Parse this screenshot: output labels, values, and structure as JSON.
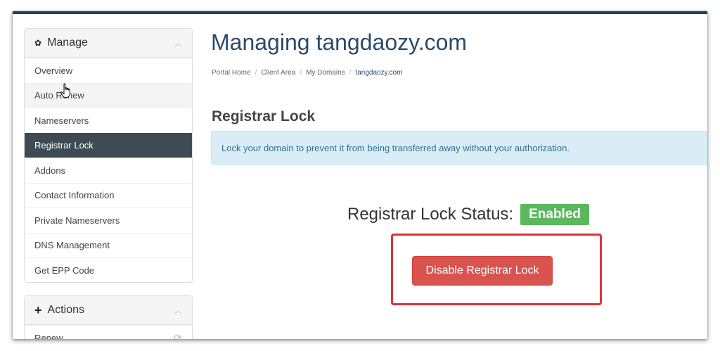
{
  "page": {
    "title": "Managing tangdaozy.com",
    "breadcrumb": [
      "Portal Home",
      "Client Area",
      "My Domains",
      "tangdaozy.com"
    ],
    "section_title": "Registrar Lock",
    "alert_text": "Lock your domain to prevent it from being transferred away without your authorization.",
    "status_label": "Registrar Lock Status:",
    "status_value": "Enabled",
    "disable_button": "Disable Registrar Lock"
  },
  "sidebar": {
    "manage_title": "Manage",
    "items": [
      {
        "label": "Overview"
      },
      {
        "label": "Auto Renew"
      },
      {
        "label": "Nameservers"
      },
      {
        "label": "Registrar Lock"
      },
      {
        "label": "Addons"
      },
      {
        "label": "Contact Information"
      },
      {
        "label": "Private Nameservers"
      },
      {
        "label": "DNS Management"
      },
      {
        "label": "Get EPP Code"
      }
    ],
    "actions_title": "Actions",
    "actions_items": [
      {
        "label": "Renew"
      }
    ]
  },
  "icons": {
    "manage": "gear-icon",
    "actions": "plus-icon",
    "collapse": "chevron-up-icon",
    "renew": "refresh-icon",
    "cursor": "hand-pointer-icon"
  },
  "colors": {
    "title": "#2b4a6b",
    "active_item": "#3d4b52",
    "badge": "#5cb85c",
    "danger_button": "#d9534f",
    "highlight_box": "#d9343a",
    "alert_bg": "#d9edf7"
  }
}
